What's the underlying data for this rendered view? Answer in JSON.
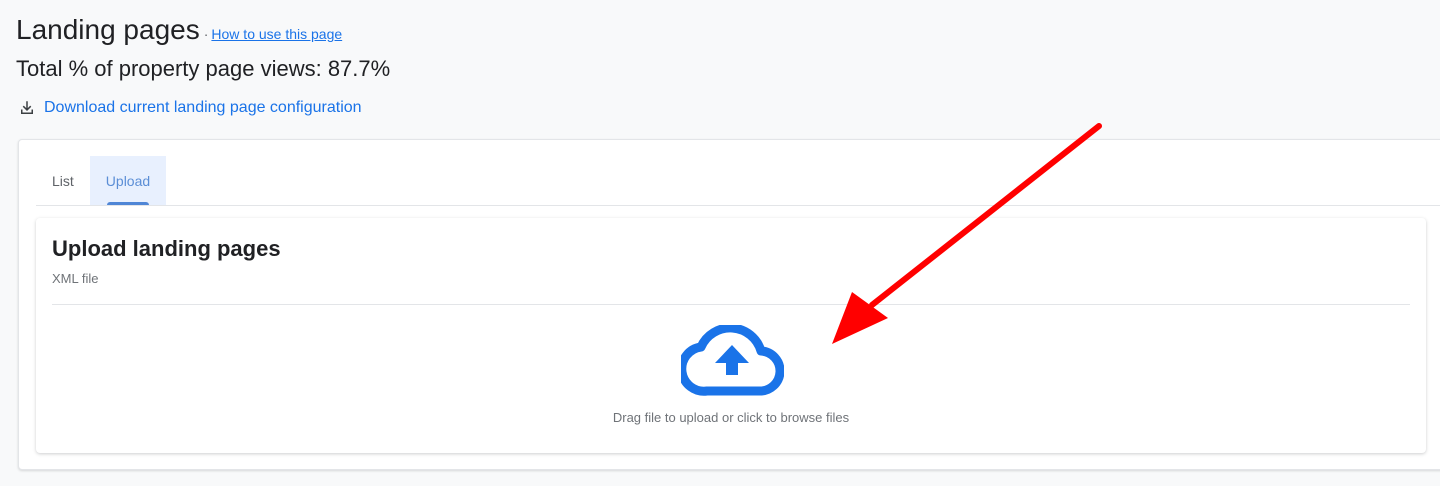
{
  "header": {
    "title": "Landing pages",
    "separator": "·",
    "help_link": "How to use this page",
    "summary": "Total % of property page views: 87.7%",
    "download_link": "Download current landing page configuration"
  },
  "tabs": [
    {
      "label": "List",
      "active": false
    },
    {
      "label": "Upload",
      "active": true
    }
  ],
  "upload": {
    "title": "Upload landing pages",
    "subtitle": "XML file",
    "dropzone_text": "Drag file to upload or click to browse files"
  },
  "icons": {
    "download": "download-icon",
    "upload": "cloud-upload-icon",
    "annotation": "red-arrow-icon"
  },
  "colors": {
    "link": "#1a73e8",
    "tab_active_bg": "#e8f0fe",
    "tab_active_text": "#5b8ed6",
    "upload_icon": "#1a73e8",
    "annotation_arrow": "#ff0000"
  }
}
